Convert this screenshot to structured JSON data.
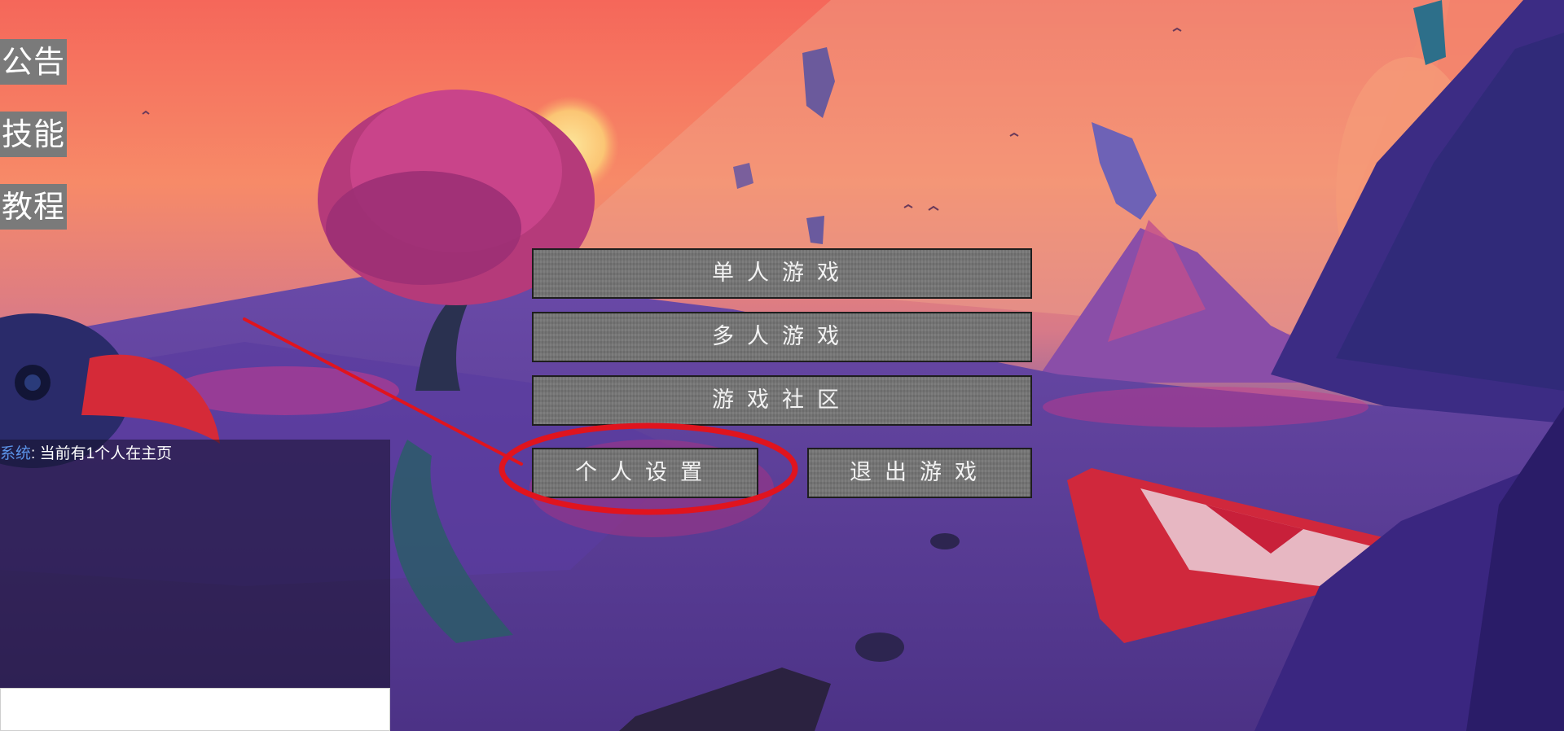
{
  "side_nav": {
    "announcement": "公告",
    "skills": "技能",
    "tutorial": "教程"
  },
  "menu": {
    "single_player": "单人游戏",
    "multi_player": "多人游戏",
    "community": "游戏社区",
    "personal_settings": "个人设置",
    "exit_game": "退出游戏"
  },
  "chat": {
    "sender": "系统",
    "separator": ": ",
    "message": "当前有1个人在主页",
    "input_value": ""
  },
  "annotation": {
    "color": "#e0141e",
    "target": "个人设置"
  },
  "colors": {
    "button_bg": "#757575",
    "side_nav_bg": "#7a7a7a",
    "chat_sender": "#5b93e8"
  },
  "icons": [
    "background-scene",
    "annotation-circle",
    "annotation-arrow-line"
  ]
}
